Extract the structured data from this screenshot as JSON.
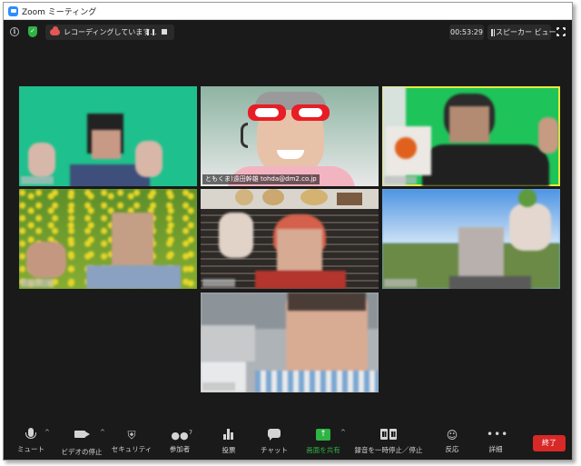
{
  "window": {
    "title": "Zoom ミーティング"
  },
  "topbar": {
    "recording_text": "レコーディングしています...",
    "timer": "00:53:29",
    "view_label": "スピーカー ビュー"
  },
  "participants": [
    {
      "name": ""
    },
    {
      "name": "ともくま)遠田幹雄 tohda@dm2.co.jp"
    },
    {
      "name": ""
    },
    {
      "name": ""
    },
    {
      "name": ""
    },
    {
      "name": ""
    },
    {
      "name": ""
    }
  ],
  "toolbar": {
    "mute": "ミュート",
    "video_stop": "ビデオの停止",
    "security": "セキュリティ",
    "participants": "参加者",
    "participants_count": "7",
    "poll": "投票",
    "chat": "チャット",
    "share_screen": "画面を共有",
    "pause_stop_recording": "録音を一時停止／停止",
    "reactions": "反応",
    "more": "詳細",
    "end": "終了"
  },
  "colors": {
    "share_green": "#2fb344",
    "end_red": "#d82828",
    "active_speaker_border": "#e8ea3c"
  }
}
